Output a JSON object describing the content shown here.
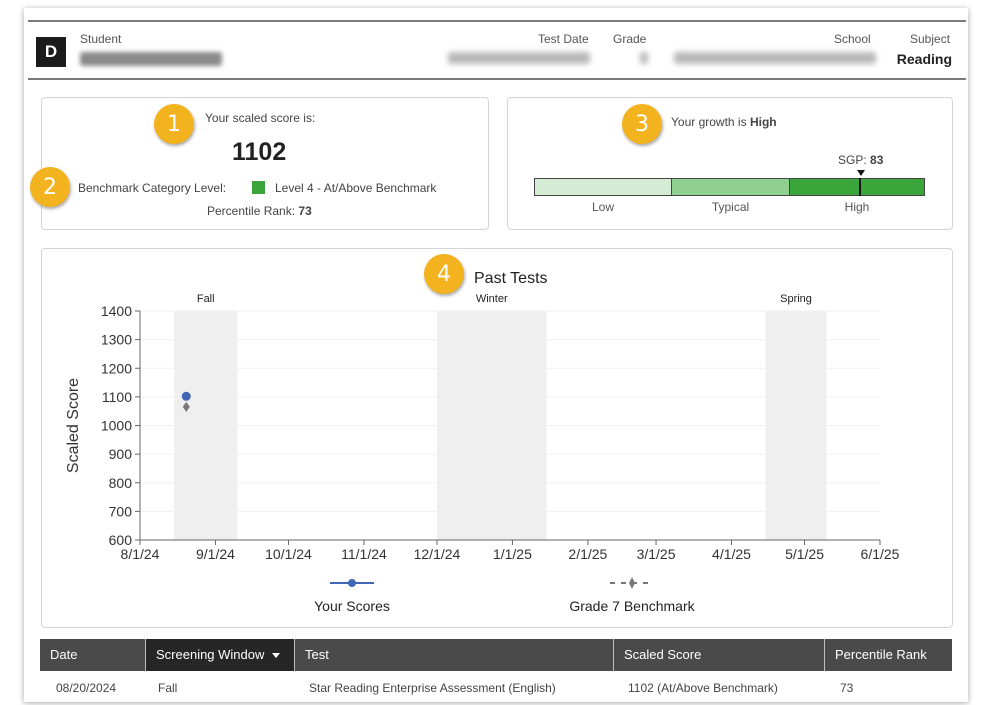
{
  "header": {
    "logo_letter": "D",
    "student_label": "Student",
    "test_date_label": "Test Date",
    "grade_label": "Grade",
    "school_label": "School",
    "subject_label": "Subject",
    "subject_value": "Reading"
  },
  "score_card": {
    "badge1": "1",
    "badge2": "2",
    "scaled_label": "Your scaled score is:",
    "scaled_value": "1102",
    "benchmark_label": "Benchmark Category Level:",
    "benchmark_value": "Level 4 - At/Above Benchmark",
    "benchmark_color": "#3aa53a",
    "percentile_label": "Percentile Rank:",
    "percentile_value": "73"
  },
  "growth_card": {
    "badge": "3",
    "growth_prefix": "Your growth is",
    "growth_value": "High",
    "sgp_label": "SGP:",
    "sgp_value": "83",
    "segments": [
      {
        "label": "Low",
        "color": "#d4ecd4"
      },
      {
        "label": "Typical",
        "color": "#8fcf8f"
      },
      {
        "label": "High",
        "color": "#3aa53a"
      }
    ]
  },
  "chart_data": {
    "type": "scatter",
    "badge": "4",
    "title": "Past Tests",
    "ylabel": "Scaled Score",
    "ylim": [
      600,
      1400
    ],
    "yticks": [
      "600",
      "700",
      "800",
      "900",
      "1000",
      "1100",
      "1200",
      "1300",
      "1400"
    ],
    "xticks": [
      "8/1/24",
      "9/1/24",
      "10/1/24",
      "11/1/24",
      "12/1/24",
      "1/1/25",
      "2/1/25",
      "3/1/25",
      "4/1/25",
      "5/1/25",
      "6/1/25"
    ],
    "windows": [
      {
        "label": "Fall",
        "start": "8/15/24",
        "end": "9/10/24"
      },
      {
        "label": "Winter",
        "start": "12/1/24",
        "end": "1/15/25"
      },
      {
        "label": "Spring",
        "start": "4/15/25",
        "end": "5/10/25"
      }
    ],
    "series": [
      {
        "name": "Your Scores",
        "color": "#3f67b5",
        "points": [
          {
            "x": "8/20/24",
            "y": 1102
          }
        ]
      },
      {
        "name": "Grade 7 Benchmark",
        "color": "#777777",
        "points": [
          {
            "x": "8/20/24",
            "y": 1065
          }
        ]
      }
    ]
  },
  "table": {
    "headers": [
      "Date",
      "Screening Window",
      "Test",
      "Scaled Score",
      "Percentile Rank"
    ],
    "rows": [
      [
        "08/20/2024",
        "Fall",
        "Star Reading Enterprise Assessment (English)",
        "1102 (At/Above Benchmark)",
        "73"
      ]
    ]
  }
}
